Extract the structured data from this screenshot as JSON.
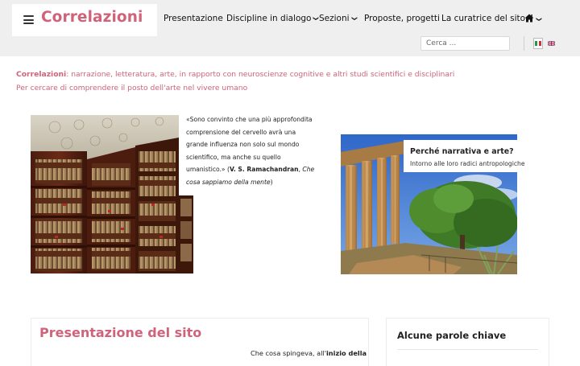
{
  "site": {
    "title": "Correlazioni"
  },
  "nav": {
    "items": [
      {
        "label": "Presentazione"
      },
      {
        "label": "Discipline in dialogo",
        "dropdown": true
      },
      {
        "label": "Sezioni",
        "dropdown": true
      },
      {
        "label": "Proposte, progetti"
      },
      {
        "label": "La curatrice del sito"
      }
    ],
    "home_icon": "home-icon",
    "home_dropdown": true
  },
  "search": {
    "placeholder": "Cerca ..."
  },
  "languages": [
    "it",
    "en"
  ],
  "tagline": {
    "brand": "Correlazioni",
    "rest": ": narrazione, letteratura, arte, in rapporto con neuroscienze cognitive e altri studi scientifici e disciplinari",
    "line2": "Per cercare di comprendere il posto dell'arte nel vivere umano"
  },
  "quote": {
    "text": "«Sono convinto che una più approfondita comprensione del cervello avrà una grande influenza non solo sul mondo scientifico, ma anche su quello umanistico.» (",
    "author": "V. S. Ramachandran",
    "sep": ", ",
    "book": "Che cosa sappiamo della mente",
    "close": ")"
  },
  "feature": {
    "title": "Perché narrativa e arte?",
    "subtitle": "Intorno alle loro radici antropologiche"
  },
  "presentation": {
    "title": "Presentazione del sito",
    "text_start": "Che cosa spingeva, all'",
    "text_bold": "inizio della"
  },
  "keywords": {
    "title": "Alcune parole chiave"
  },
  "colors": {
    "accent": "#d0637a",
    "header_bg": "#efefef"
  }
}
